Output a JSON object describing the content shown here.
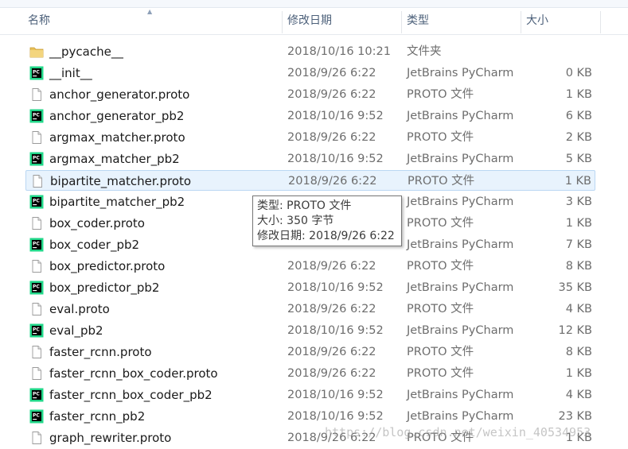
{
  "columns": {
    "name": "名称",
    "date": "修改日期",
    "type": "类型",
    "size": "大小"
  },
  "rows": [
    {
      "icon": "folder-icon",
      "name": "__pycache__",
      "date": "2018/10/16 10:21",
      "type": "文件夹",
      "size": ""
    },
    {
      "icon": "pycharm-icon",
      "name": "__init__",
      "date": "2018/9/26 6:22",
      "type": "JetBrains PyCharm",
      "size": "0 KB"
    },
    {
      "icon": "file-icon",
      "name": "anchor_generator.proto",
      "date": "2018/9/26 6:22",
      "type": "PROTO 文件",
      "size": "1 KB"
    },
    {
      "icon": "pycharm-icon",
      "name": "anchor_generator_pb2",
      "date": "2018/10/16 9:52",
      "type": "JetBrains PyCharm",
      "size": "6 KB"
    },
    {
      "icon": "file-icon",
      "name": "argmax_matcher.proto",
      "date": "2018/9/26 6:22",
      "type": "PROTO 文件",
      "size": "2 KB"
    },
    {
      "icon": "pycharm-icon",
      "name": "argmax_matcher_pb2",
      "date": "2018/10/16 9:52",
      "type": "JetBrains PyCharm",
      "size": "5 KB"
    },
    {
      "icon": "file-icon",
      "name": "bipartite_matcher.proto",
      "date": "2018/9/26 6:22",
      "type": "PROTO 文件",
      "size": "1 KB"
    },
    {
      "icon": "pycharm-icon",
      "name": "bipartite_matcher_pb2",
      "date": "",
      "type": "JetBrains PyCharm",
      "size": "3 KB"
    },
    {
      "icon": "file-icon",
      "name": "box_coder.proto",
      "date": "",
      "type": "PROTO 文件",
      "size": "1 KB"
    },
    {
      "icon": "pycharm-icon",
      "name": "box_coder_pb2",
      "date": "",
      "type": "JetBrains PyCharm",
      "size": "7 KB"
    },
    {
      "icon": "file-icon",
      "name": "box_predictor.proto",
      "date": "2018/9/26 6:22",
      "type": "PROTO 文件",
      "size": "8 KB"
    },
    {
      "icon": "pycharm-icon",
      "name": "box_predictor_pb2",
      "date": "2018/10/16 9:52",
      "type": "JetBrains PyCharm",
      "size": "35 KB"
    },
    {
      "icon": "file-icon",
      "name": "eval.proto",
      "date": "2018/9/26 6:22",
      "type": "PROTO 文件",
      "size": "4 KB"
    },
    {
      "icon": "pycharm-icon",
      "name": "eval_pb2",
      "date": "2018/10/16 9:52",
      "type": "JetBrains PyCharm",
      "size": "12 KB"
    },
    {
      "icon": "file-icon",
      "name": "faster_rcnn.proto",
      "date": "2018/9/26 6:22",
      "type": "PROTO 文件",
      "size": "8 KB"
    },
    {
      "icon": "file-icon",
      "name": "faster_rcnn_box_coder.proto",
      "date": "2018/9/26 6:22",
      "type": "PROTO 文件",
      "size": "1 KB"
    },
    {
      "icon": "pycharm-icon",
      "name": "faster_rcnn_box_coder_pb2",
      "date": "2018/10/16 9:52",
      "type": "JetBrains PyCharm",
      "size": "4 KB"
    },
    {
      "icon": "pycharm-icon",
      "name": "faster_rcnn_pb2",
      "date": "2018/10/16 9:52",
      "type": "JetBrains PyCharm",
      "size": "23 KB"
    },
    {
      "icon": "file-icon",
      "name": "graph_rewriter.proto",
      "date": "2018/9/26 6:22",
      "type": "PROTO 文件",
      "size": "1 KB"
    }
  ],
  "hovered_row": 6,
  "tooltip": {
    "type_line": "类型: PROTO 文件",
    "size_line": "大小: 350 字节",
    "date_line": "修改日期: 2018/9/26 6:22"
  },
  "watermark": "https://blog.csdn.net/weixin_40534953",
  "colors": {
    "header_text": "#4c607a",
    "hover_bg": "#e8f3fd",
    "hover_border": "#bad7f3",
    "folder": "#e8c15a",
    "pycharm_green": "#21d789"
  }
}
